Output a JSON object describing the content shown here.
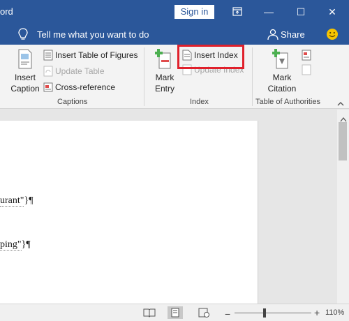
{
  "titlebar": {
    "app_title": "ord",
    "signin_label": "Sign in",
    "restore_icon": "ribbon-display-icon",
    "minimize_glyph": "—",
    "maximize_glyph": "☐",
    "close_glyph": "✕"
  },
  "tellbar": {
    "tell_me": "Tell me what you want to do",
    "share_label": "Share"
  },
  "ribbon": {
    "captions": {
      "group_label": "Captions",
      "insert_caption_line1": "Insert",
      "insert_caption_line2": "Caption",
      "insert_table_of_figures": "Insert Table of Figures",
      "update_table": "Update Table",
      "cross_reference": "Cross-reference"
    },
    "index": {
      "group_label": "Index",
      "mark_entry_line1": "Mark",
      "mark_entry_line2": "Entry",
      "insert_index": "Insert Index",
      "update_index": "Update Index"
    },
    "authorities": {
      "group_label": "Table of Authorities",
      "mark_citation_line1": "Mark",
      "mark_citation_line2": "Citation"
    }
  },
  "document": {
    "field1": "urant\"",
    "field1_end": "}¶",
    "field2": "ping\"",
    "field2_end": "}¶"
  },
  "statusbar": {
    "zoom_minus": "−",
    "zoom_plus": "+",
    "zoom_level": "110%"
  },
  "colors": {
    "title_blue": "#2b579a",
    "highlight_red": "#e0212c"
  }
}
